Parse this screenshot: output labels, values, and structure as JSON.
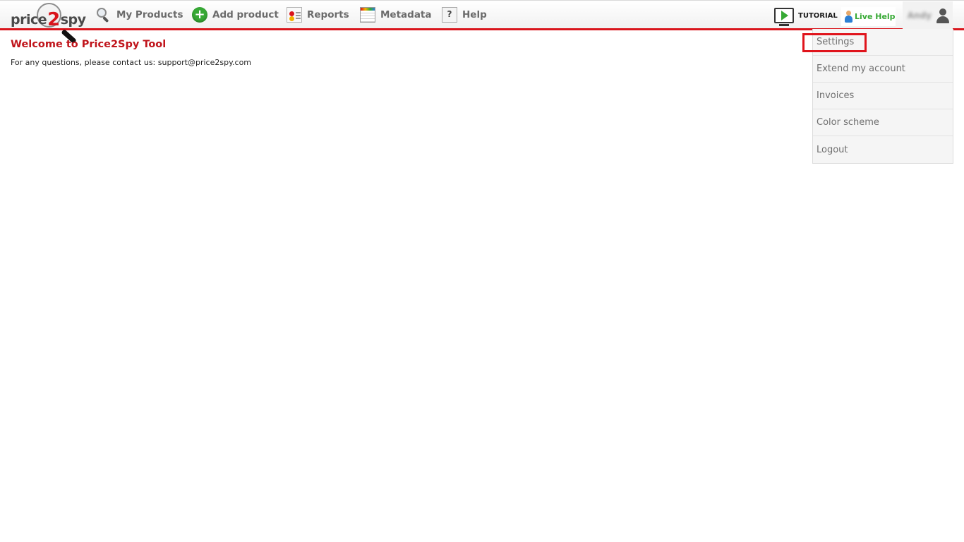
{
  "logo": {
    "part1": "price",
    "part2": "2",
    "part3": "spy"
  },
  "nav": {
    "my_products": "My Products",
    "add_product": "Add product",
    "reports": "Reports",
    "metadata": "Metadata",
    "help": "Help"
  },
  "header": {
    "tutorial": "TUTORIAL",
    "live_help": "Live Help",
    "user_name": "Andy"
  },
  "main": {
    "welcome": "Welcome to Price2Spy Tool",
    "contact": "For any questions, please contact us: support@price2spy.com"
  },
  "user_menu": {
    "items": [
      "Settings",
      "Extend my account",
      "Invoices",
      "Color scheme",
      "Logout"
    ]
  },
  "colors": {
    "accent": "#d9151c",
    "heading": "#c0141b",
    "green": "#37a935"
  }
}
